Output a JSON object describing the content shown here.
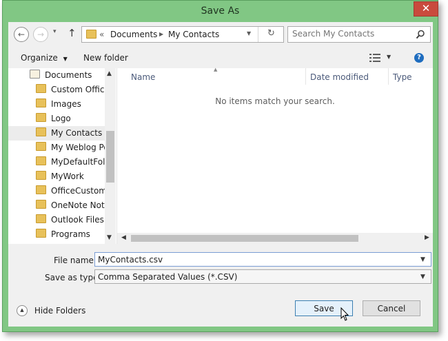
{
  "window": {
    "title": "Save As",
    "close_label": "✕"
  },
  "nav": {
    "back_label": "←",
    "forward_label": "→",
    "recent_label": "▾",
    "up_label": "↑",
    "breadcrumb_overflow": "«",
    "breadcrumb": [
      "Documents",
      "My Contacts"
    ],
    "refresh_label": "↻",
    "search_placeholder": "Search My Contacts"
  },
  "toolbar": {
    "organize_label": "Organize",
    "new_folder_label": "New folder",
    "help_label": "?"
  },
  "tree": {
    "items": [
      {
        "label": "Documents"
      },
      {
        "label": "Custom Office"
      },
      {
        "label": "Images"
      },
      {
        "label": "Logo"
      },
      {
        "label": "My Contacts"
      },
      {
        "label": "My Weblog Po"
      },
      {
        "label": "MyDefaultFold"
      },
      {
        "label": "MyWork"
      },
      {
        "label": "OfficeCustomiz"
      },
      {
        "label": "OneNote Notel"
      },
      {
        "label": "Outlook Files"
      },
      {
        "label": "Programs"
      }
    ]
  },
  "file_list": {
    "columns": [
      "Name",
      "Date modified",
      "Type"
    ],
    "empty_message": "No items match your search."
  },
  "form": {
    "file_name_label": "File name:",
    "file_name_value": "MyContacts.csv",
    "save_type_label": "Save as type:",
    "save_type_value": "Comma Separated Values (*.CSV)"
  },
  "footer": {
    "hide_folders_label": "Hide Folders",
    "save_label": "Save",
    "cancel_label": "Cancel"
  }
}
